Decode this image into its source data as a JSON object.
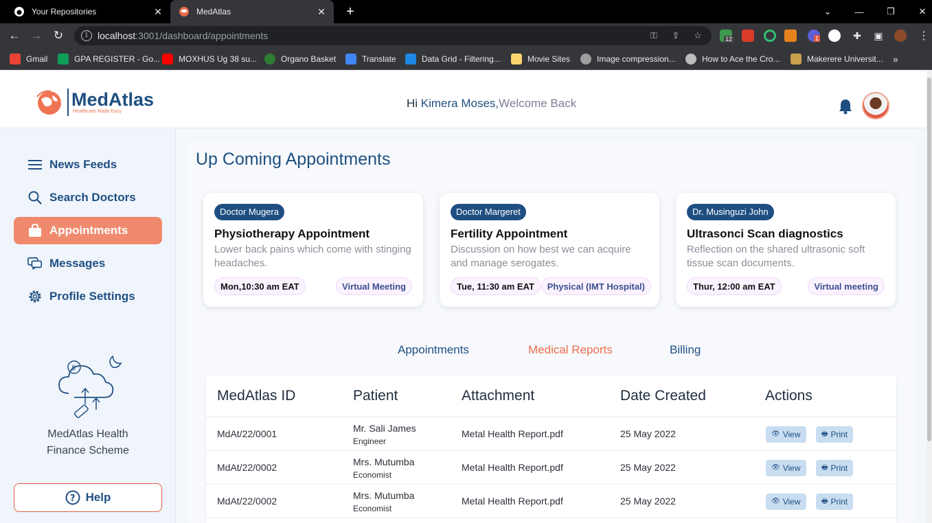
{
  "browser": {
    "tabs": [
      {
        "title": "Your Repositories",
        "icon": "github-icon"
      },
      {
        "title": "MedAtlas",
        "icon": "medatlas-icon"
      }
    ],
    "url_host": "localhost",
    "url_path": ":3001/dashboard/appointments",
    "bookmarks": [
      {
        "label": "Gmail",
        "color": "#ea4335"
      },
      {
        "label": "GPA REGISTER - Go...",
        "color": "#0f9d58"
      },
      {
        "label": "MOXHUS Ug 38 su...",
        "color": "#ff0000"
      },
      {
        "label": "Organo Basket",
        "color": "#2e7d32"
      },
      {
        "label": "Translate",
        "color": "#4285f4"
      },
      {
        "label": "Data Grid - Filtering...",
        "color": "#1e88e5"
      },
      {
        "label": "Movie Sites",
        "color": "#f9d56e"
      },
      {
        "label": "Image compression...",
        "color": "#9e9e9e"
      },
      {
        "label": "How to Ace the Cro...",
        "color": "#bdbdbd"
      },
      {
        "label": "Makerere Universit...",
        "color": "#c8a24a"
      }
    ],
    "ext_badge": "12",
    "ext_badge2": "1"
  },
  "header": {
    "brand": "MedAtlas",
    "tagline": "Healthcare Made Easy",
    "greeting_hi": "Hi ",
    "user_name": "Kimera Moses,",
    "welcome": "Welcome Back"
  },
  "sidebar": {
    "items": [
      {
        "label": "News Feeds",
        "icon": "menu-icon"
      },
      {
        "label": "Search Doctors",
        "icon": "search-icon"
      },
      {
        "label": "Appointments",
        "icon": "bag-icon"
      },
      {
        "label": "Messages",
        "icon": "chat-icon"
      },
      {
        "label": "Profile Settings",
        "icon": "gear-icon"
      }
    ],
    "finance_line1": "MedAtlas Health",
    "finance_line2": "Finance Scheme",
    "help": "Help"
  },
  "main": {
    "title": "Up Coming Appointments",
    "cards": [
      {
        "doctor": "Doctor Mugera",
        "title": "Physiotherapy Appointment",
        "desc": "Lower back pains which come with stinging headaches.",
        "time": "Mon,10:30 am EAT",
        "location": "Virtual Meeting"
      },
      {
        "doctor": "Doctor Margeret",
        "title": "Fertility Appointment",
        "desc": "Discussion on how best we can acquire and manage serogates.",
        "time": "Tue, 11:30 am EAT",
        "location": "Physical (IMT Hospital)"
      },
      {
        "doctor": "Dr. Musinguzi John",
        "title": "Ultrasonci Scan diagnostics",
        "desc": "Reflection on the shared ultrasonic soft tissue scan documents.",
        "time": "Thur, 12:00 am EAT",
        "location": "Virtual meeting"
      }
    ],
    "tabs": [
      "Appointments",
      "Medical Reports",
      "Billing"
    ],
    "table": {
      "headers": [
        "MedAtlas ID",
        "Patient",
        "Attachment",
        "Date Created",
        "Actions"
      ],
      "rows": [
        {
          "id": "MdAt/22/0001",
          "patient": "Mr. Sali James",
          "role": "Engineer",
          "attachment": "Metal Health Report.pdf",
          "date": "25 May 2022"
        },
        {
          "id": "MdAt/22/0002",
          "patient": "Mrs. Mutumba",
          "role": "Economist",
          "attachment": "Metal Health Report.pdf",
          "date": "25 May 2022"
        },
        {
          "id": "MdAt/22/0002",
          "patient": "Mrs. Mutumba",
          "role": "Economist",
          "attachment": "Metal Health Report.pdf",
          "date": "25 May 2022"
        }
      ],
      "view_label": "View",
      "print_label": "Print"
    }
  },
  "colors": {
    "primary": "#1f4f82",
    "accent": "#f08a6e",
    "accent_text": "#ef6c4e"
  }
}
